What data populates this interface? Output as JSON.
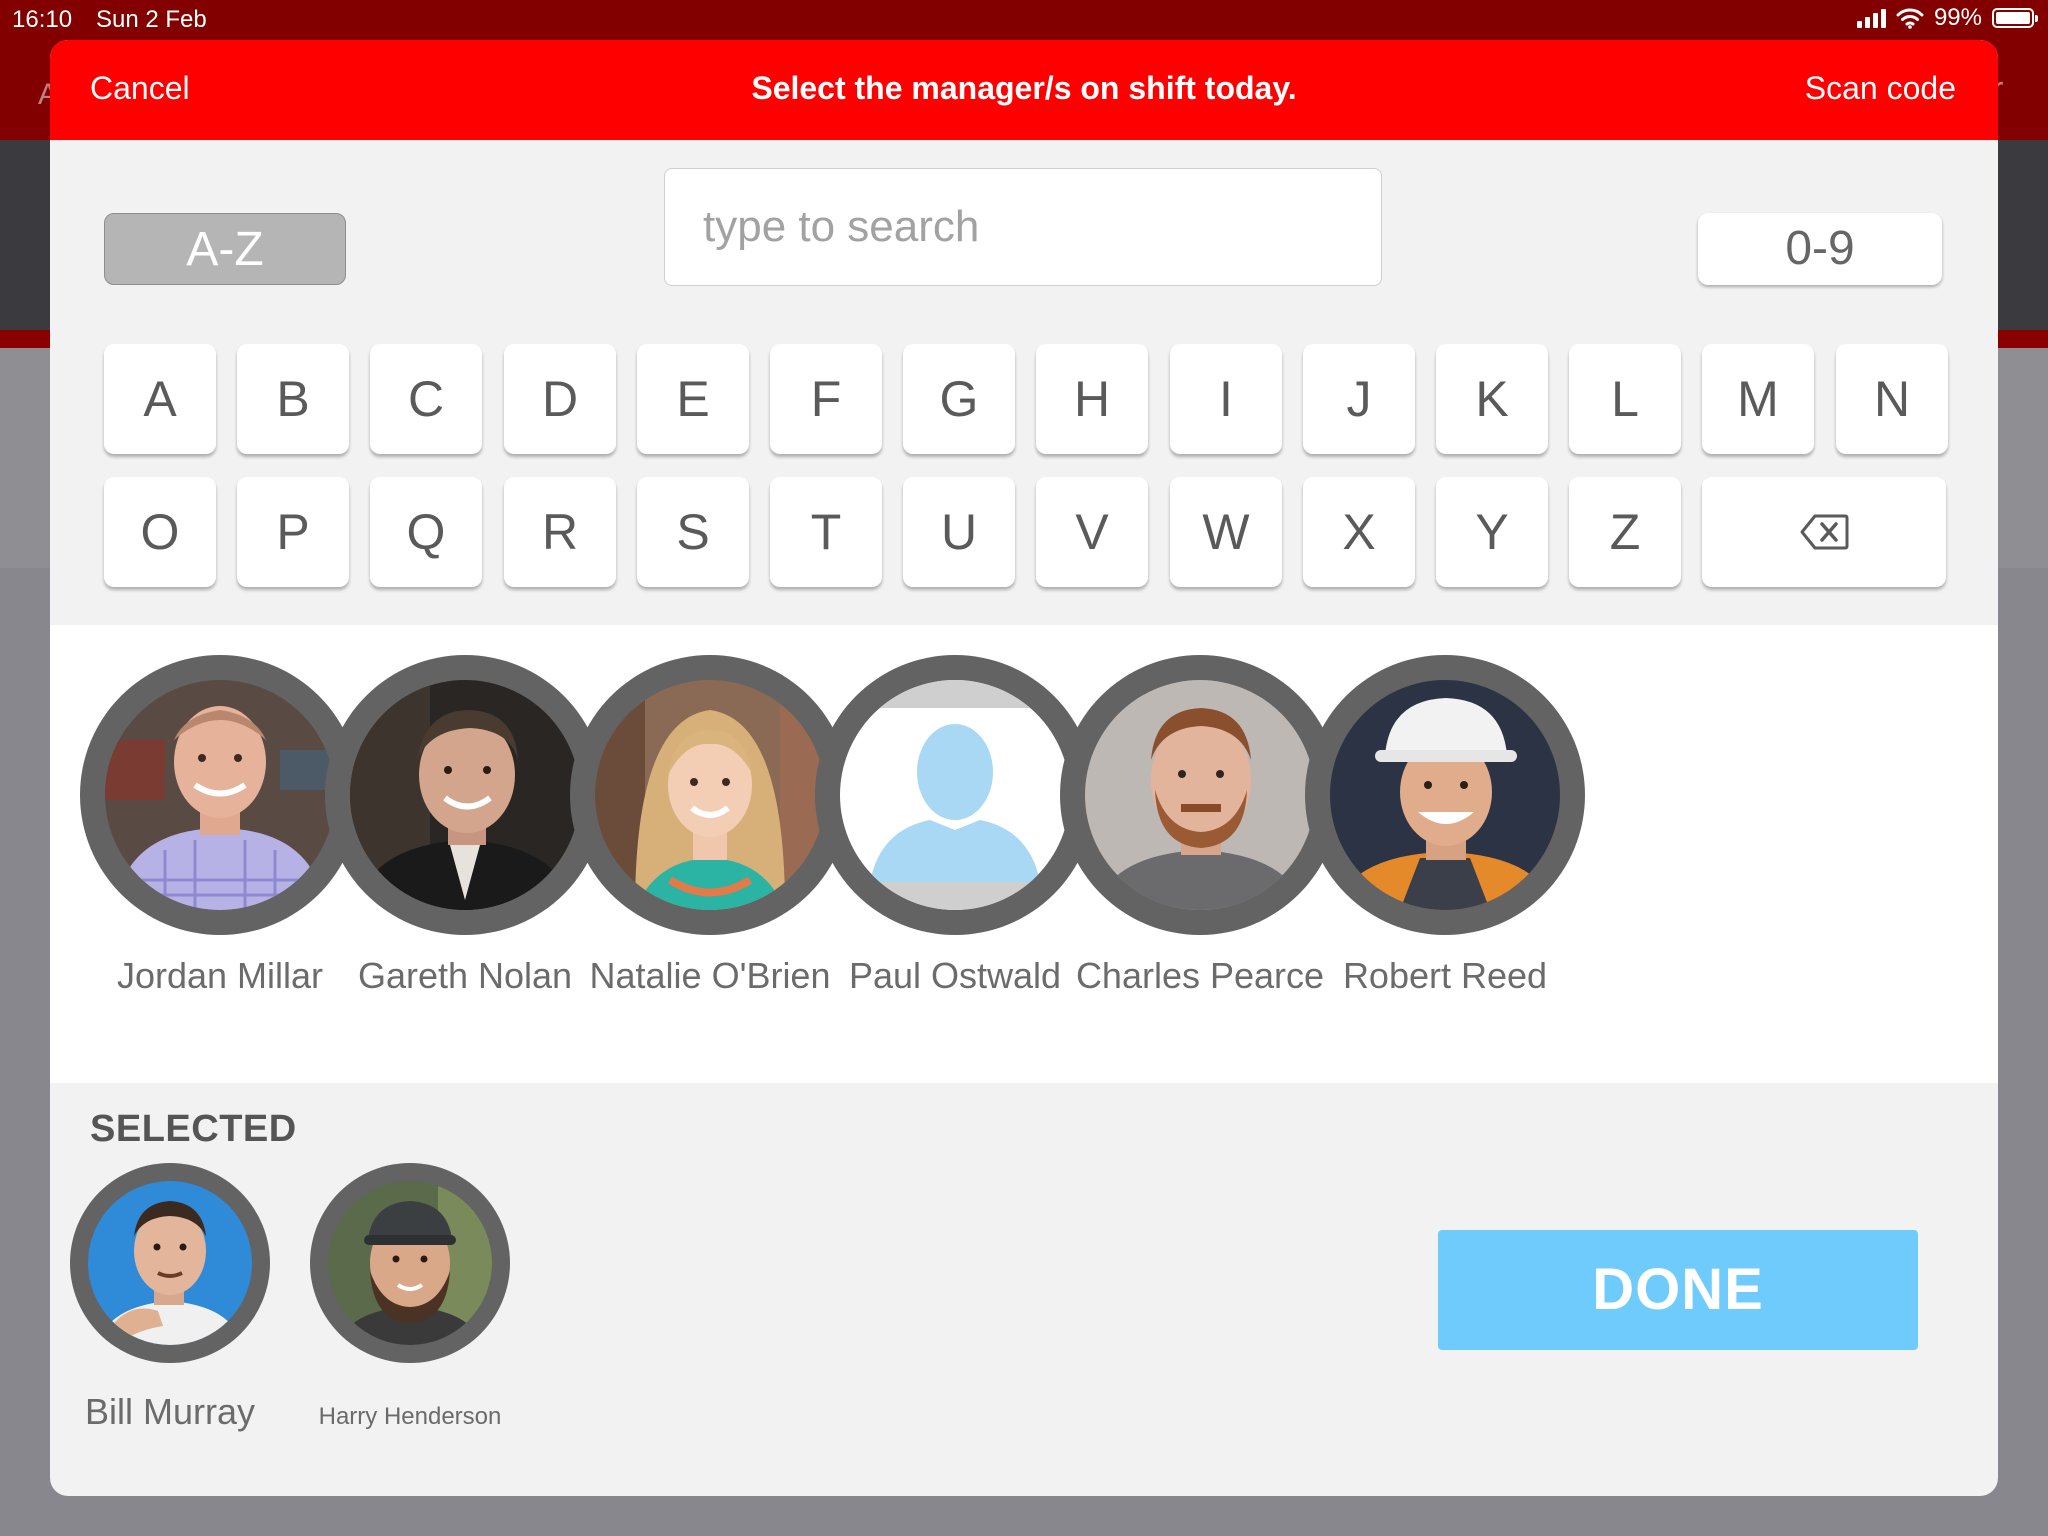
{
  "status_bar": {
    "time": "16:10",
    "date": "Sun 2 Feb",
    "battery": "99%",
    "battery_level": 0.99
  },
  "background": {
    "edge_left": "A",
    "edge_right": "r"
  },
  "header": {
    "cancel": "Cancel",
    "title": "Select the manager/s on shift today.",
    "scan": "Scan code"
  },
  "filters": {
    "az": "A-Z",
    "num": "0-9"
  },
  "search": {
    "placeholder": "type to search",
    "value": ""
  },
  "keyboard": {
    "row1": [
      "A",
      "B",
      "C",
      "D",
      "E",
      "F",
      "G",
      "H",
      "I",
      "J",
      "K",
      "L",
      "M",
      "N"
    ],
    "row2": [
      "O",
      "P",
      "Q",
      "R",
      "S",
      "T",
      "U",
      "V",
      "W",
      "X",
      "Y",
      "Z"
    ],
    "backspace_icon": "backspace-icon"
  },
  "managers": [
    {
      "name": "Jordan Millar",
      "photo": "photo-man-plaid-shirt"
    },
    {
      "name": "Gareth Nolan",
      "photo": "photo-man-dark-jacket"
    },
    {
      "name": "Natalie O'Brien",
      "photo": "photo-woman-blonde"
    },
    {
      "name": "Paul Ostwald",
      "photo": "default-avatar-icon"
    },
    {
      "name": "Charles Pearce",
      "photo": "photo-man-beard"
    },
    {
      "name": "Robert Reed",
      "photo": "photo-man-hard-hat"
    }
  ],
  "selected": {
    "label": "SELECTED",
    "people": [
      {
        "name": "Bill Murray",
        "photo": "photo-man-pointing"
      },
      {
        "name": "Harry Henderson",
        "photo": "photo-man-cap-beard"
      }
    ]
  },
  "done": "DONE",
  "colors": {
    "header_red": "#fe0000",
    "done_blue": "#6ecbfb",
    "avatar_ring": "#636363"
  }
}
